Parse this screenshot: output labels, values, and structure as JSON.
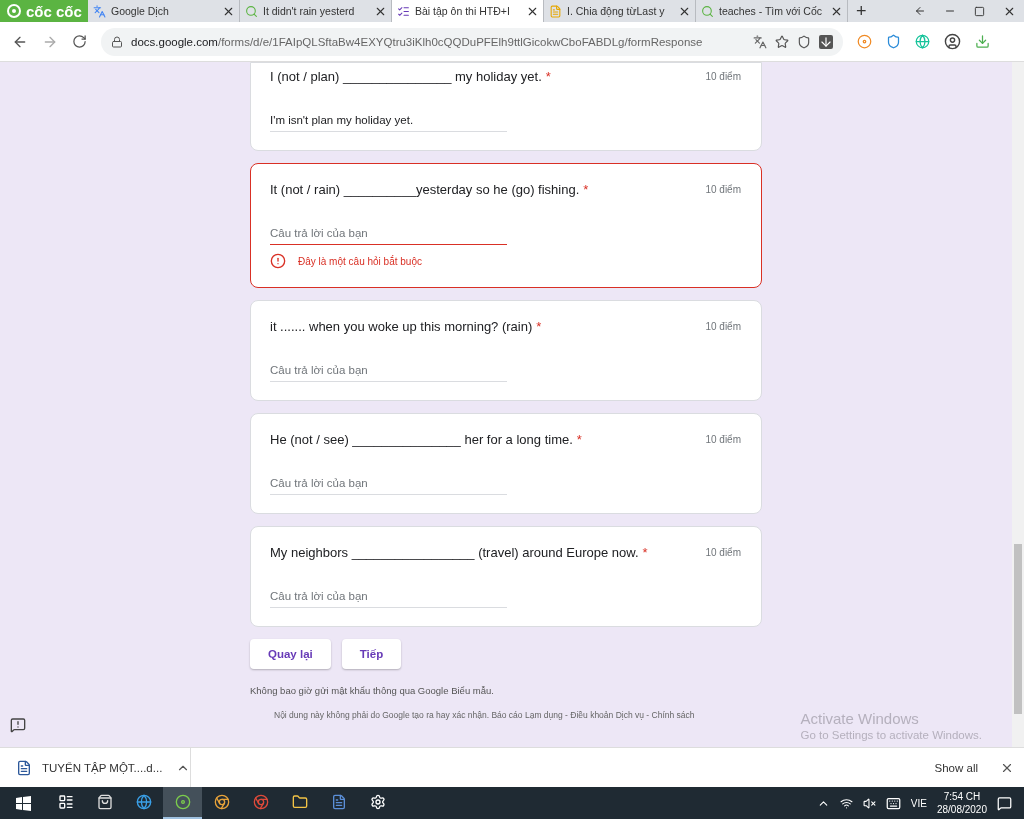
{
  "browser": {
    "brand": "cốc cốc",
    "tabs": [
      {
        "title": "Google Dịch",
        "selected": false,
        "kind": "translate"
      },
      {
        "title": "It didn't rain yesterd",
        "selected": false,
        "kind": "search"
      },
      {
        "title": "Bài tập ôn thi HTĐ+I",
        "selected": true,
        "kind": "forms"
      },
      {
        "title": "I. Chia động từLast y",
        "selected": false,
        "kind": "site"
      },
      {
        "title": "teaches - Tìm với Cốc",
        "selected": false,
        "kind": "search"
      }
    ],
    "new_tab": "+",
    "address": {
      "host": "docs.google.com",
      "path": "/forms/d/e/1FAIpQLSftaBw4EXYQtru3iKlh0cQQDuPFElh9ttlGicokwCboFABDLg/formResponse"
    }
  },
  "form": {
    "questions": [
      {
        "title": "I (not / plan) _______________ my holiday yet.",
        "required": true,
        "points": "10 điểm",
        "answer": "I'm isn't plan my holiday yet.",
        "error": false
      },
      {
        "title": "It (not / rain) __________yesterday so he (go) fishing.",
        "required": true,
        "points": "10 điểm",
        "placeholder": "Câu trả lời của bạn",
        "error": true,
        "error_text": "Đây là một câu hỏi bắt buộc"
      },
      {
        "title": "it ....... when you woke up this morning? (rain)",
        "required": true,
        "points": "10 điểm",
        "placeholder": "Câu trả lời của bạn",
        "error": false
      },
      {
        "title": "He (not / see) _______________ her for a long time.",
        "required": true,
        "points": "10 điểm",
        "placeholder": "Câu trả lời của bạn",
        "error": false
      },
      {
        "title": "My neighbors _________________ (travel) around Europe now.",
        "required": true,
        "points": "10 điểm",
        "placeholder": "Câu trả lời của bạn",
        "error": false
      }
    ],
    "required_mark": "*",
    "buttons": [
      "Quay lại",
      "Tiếp"
    ],
    "notice": "Không bao giờ gửi mật khẩu thông qua Google Biểu mẫu.",
    "footer": "Nội dung này không phải do Google tạo ra hay xác nhận. Báo cáo Lạm dụng - Điều khoản Dịch vụ - Chính sách"
  },
  "activation": {
    "title": "Activate Windows",
    "subtitle": "Go to Settings to activate Windows."
  },
  "download_bar": {
    "file": "TUYỂN TẬP MỘT....d...",
    "show_all": "Show all"
  },
  "taskbar": {
    "apps": [
      {
        "kind": "taskview",
        "active": false
      },
      {
        "kind": "store",
        "active": false
      },
      {
        "kind": "edge",
        "active": false
      },
      {
        "kind": "coccoc",
        "active": true
      },
      {
        "kind": "chrome-user",
        "active": false
      },
      {
        "kind": "chrome",
        "active": false
      },
      {
        "kind": "folder",
        "active": false
      },
      {
        "kind": "word",
        "active": false
      },
      {
        "kind": "settings",
        "active": false
      }
    ],
    "language": "VIE",
    "time": "7:54 CH",
    "date": "28/08/2020"
  }
}
